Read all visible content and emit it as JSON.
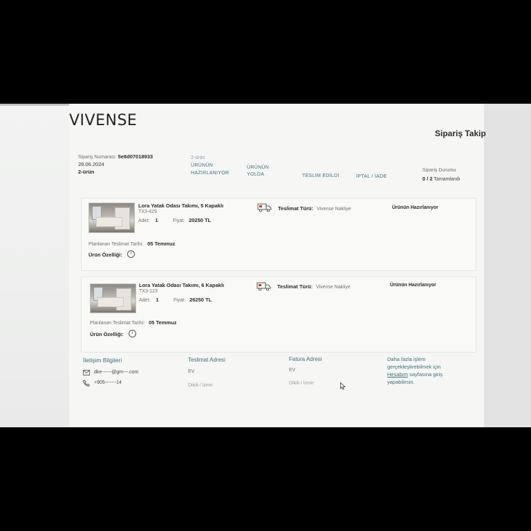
{
  "brand": {
    "logo": "VIVENSE"
  },
  "page": {
    "title": "Sipariş Takip"
  },
  "order": {
    "number_label": "Sipariş Numarası:",
    "number": "5e8d07018933",
    "date": "28.06.2024",
    "item_count": "2-ürün"
  },
  "stages": {
    "preparing_count": "2-ürün",
    "preparing_line1": "ÜRÜNÜN",
    "preparing_line2": "HAZIRLANIYOR",
    "shipping_line1": "ÜRÜNÜN",
    "shipping_line2": "YOLDA",
    "delivered": "TESLİM EDİLDİ",
    "cancel_return": "İPTAL / İADE"
  },
  "order_status": {
    "label": "Sipariş Durumu",
    "count": "0 / 2",
    "value": "Tamamlandı"
  },
  "items": [
    {
      "name": "Lora Yatak Odası Takımı, 5 Kapaklı",
      "sku": "TX3-429",
      "qty_label": "Adet:",
      "qty": "1",
      "price_label": "Fiyat:",
      "price": "20250 TL",
      "delivery_type_label": "Teslimat Türü:",
      "delivery_type": "Vivense Nakliye",
      "status": "Ürünün Hazırlanıyor",
      "planned_label": "Planlanan Teslimat Tarihi:",
      "planned_date": "05 Temmuz",
      "features_label": "Ürün Özelliği:"
    },
    {
      "name": "Lora Yatak Odası Takımı, 6 Kapaklı",
      "sku": "TX3-123",
      "qty_label": "Adet:",
      "qty": "1",
      "price_label": "Fiyat:",
      "price": "26250 TL",
      "delivery_type_label": "Teslimat Türü:",
      "delivery_type": "Vivense Nakliye",
      "status": "Ürünün Hazırlanıyor",
      "planned_label": "Planlanan Teslimat Tarihi:",
      "planned_date": "05 Temmuz",
      "features_label": "Ürün Özelliği:"
    }
  ],
  "contact": {
    "title": "İletişim Bilgileri",
    "email": "dke------@gm---.com",
    "phone": "+905-------14"
  },
  "delivery_address": {
    "title": "Teslimat Adresi",
    "type": "EV",
    "city": "Dikili / İzmir"
  },
  "invoice_address": {
    "title": "Fatura Adresi",
    "type": "EV",
    "city": "Dikili / İzmir"
  },
  "account_note": {
    "line1": "Daha fazla işlem",
    "line2": "gerçekleştirebilmek için",
    "link": "Hesabım",
    "line3": "sayfasına giriş",
    "line4": "yapabilirsin."
  },
  "colors": {
    "accent": "#3c6e7c",
    "text": "#2a2a2a",
    "background": "#f2f3f2"
  },
  "icons": [
    "truck-icon",
    "info-icon",
    "mail-icon",
    "phone-icon",
    "cursor-icon"
  ]
}
